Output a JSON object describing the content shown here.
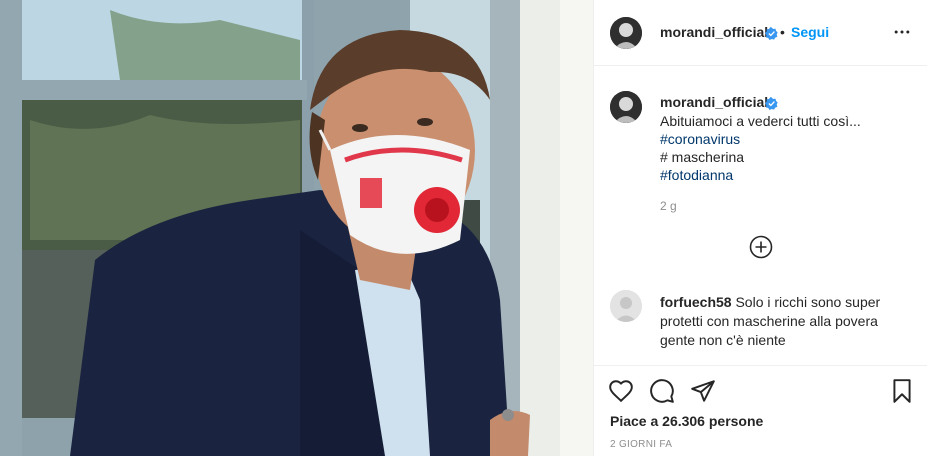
{
  "post": {
    "username": "morandi_official",
    "separator": "•",
    "follow_label": "Segui",
    "caption": {
      "line1": "Abituiamoci a vederci tutti così...",
      "tag1": "#coronavirus",
      "line3": "# mascherina",
      "tag2": "#fotodianna"
    },
    "caption_time": "2 g",
    "likes_label": "Piace a 26.306 persone",
    "timestamp": "2 giorni fa"
  },
  "comments": [
    {
      "username": "forfuech58",
      "text": "Solo i ricchi sono super protetti con mascherine alla povera gente non c'è niente"
    }
  ],
  "icons": {
    "verified": "verified-badge-icon",
    "more": "more-options-icon",
    "load_more": "plus-circle-icon",
    "like": "heart-icon",
    "comment": "comment-bubble-icon",
    "share": "paper-plane-icon",
    "save": "bookmark-icon"
  },
  "colors": {
    "link_blue": "#0095f6",
    "hashtag": "#00376b",
    "muted": "#8e8e8e",
    "verified": "#3897f0"
  }
}
